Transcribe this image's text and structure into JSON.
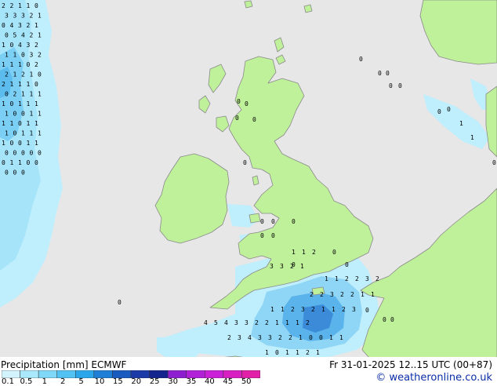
{
  "map": {
    "colors": {
      "sea": "#e7e7e7",
      "land": "#bff09a",
      "coast": "#8a8a8a",
      "precip_light": "#bfeefd",
      "precip_mid": "#8fd6f6",
      "precip_heavy": "#5ab3ea",
      "precip_dark": "#3b8bd8"
    }
  },
  "footer": {
    "title_left": "Precipitation [mm] ECMWF",
    "title_right": "Fr 31-01-2025 12..15 UTC (00+87)",
    "credit": "© weatheronline.co.uk",
    "legend": {
      "ticks": [
        "0.1",
        "0.5",
        "1",
        "2",
        "5",
        "10",
        "15",
        "20",
        "25",
        "30",
        "35",
        "40",
        "45",
        "50"
      ],
      "colors": [
        "#d4f4fd",
        "#aae8fb",
        "#80d8f8",
        "#52c2f3",
        "#2aa7ea",
        "#1f7fd6",
        "#1a5bc0",
        "#1a3aa8",
        "#15238e",
        "#8d1fd0",
        "#b021d8",
        "#c920d8",
        "#d820c2",
        "#e21fa8"
      ]
    }
  },
  "chart_data": {
    "type": "heatmap",
    "title": "Precipitation [mm] ECMWF",
    "valid_time": "Fr 31-01-2025 12..15 UTC (00+87)",
    "units": "mm",
    "scale": [
      0.1,
      0.5,
      1,
      2,
      5,
      10,
      15,
      20,
      25,
      30,
      35,
      40,
      45,
      50
    ],
    "grid_values": {
      "west_atlantic_column": [
        2,
        2,
        1,
        1,
        0,
        3,
        3,
        3,
        2,
        1,
        0,
        4,
        3,
        2,
        1,
        0,
        5,
        4,
        2,
        1,
        1,
        0,
        4,
        3,
        2,
        1,
        1,
        0,
        3,
        2,
        1,
        1,
        1,
        0,
        2,
        2,
        1,
        2,
        1,
        0,
        2,
        1,
        1,
        1,
        0,
        0,
        2,
        1,
        1,
        1,
        1,
        0,
        1,
        1,
        1,
        1,
        0,
        0,
        1,
        1,
        1,
        1,
        0,
        1,
        1,
        1,
        0,
        1,
        1,
        1,
        1,
        0,
        0,
        1,
        1,
        0,
        0,
        0,
        0,
        0,
        0,
        1,
        1,
        0,
        0,
        0,
        0,
        0
      ],
      "english_channel": [
        1,
        1,
        2,
        3,
        3,
        2,
        1,
        1,
        1,
        2,
        2,
        3,
        2,
        2,
        2,
        3,
        2,
        2,
        1,
        1,
        1,
        1,
        2,
        3,
        2,
        1,
        1,
        2,
        3,
        4,
        5,
        4,
        3,
        3,
        2,
        2,
        1,
        1,
        1,
        2,
        2,
        3,
        4,
        3,
        3,
        2,
        2,
        1,
        0,
        0,
        1,
        1,
        1,
        0,
        1,
        1,
        2,
        1
      ],
      "scattered_land_sea": [
        0,
        0,
        0,
        0,
        0,
        0,
        0,
        0,
        0,
        0,
        0,
        0,
        0,
        0,
        0,
        0,
        0,
        0,
        0,
        1,
        1,
        0,
        0,
        0,
        0,
        0,
        0
      ]
    }
  }
}
